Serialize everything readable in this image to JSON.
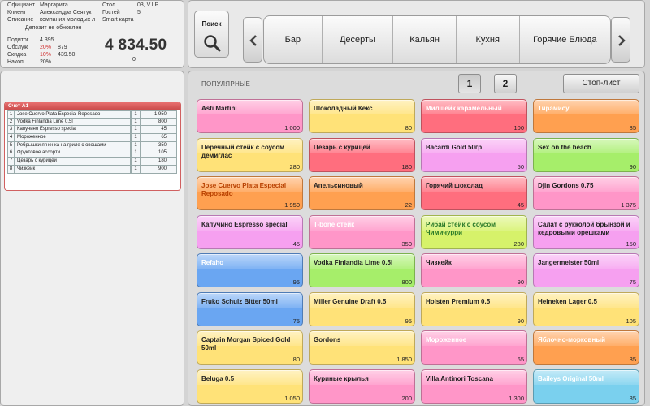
{
  "order_info": {
    "waiter_label": "Официант",
    "waiter_value": "Маргарита",
    "client_label": "Клиент",
    "client_value": "Александра Сеятук",
    "description_label": "Описание",
    "description_value": "компания молодых л",
    "table_label": "Стол",
    "table_value": "03, V.I.P",
    "guests_label": "Гостей",
    "guests_value": "5",
    "card_value": "Smart карта",
    "deposit_status": "Депозит не обновлен",
    "subtotal_label": "Подитог",
    "subtotal_value": "4 395",
    "service_label": "Обслуж",
    "service_percent": "20%",
    "service_value": "879",
    "discount_label": "Скидка",
    "discount_percent": "10%",
    "discount_value": "439.50",
    "accum_label": "Накоп.",
    "accum_percent": "20%",
    "total": "4 834.50",
    "paid": "0"
  },
  "search": {
    "label": "Поиск"
  },
  "categories": [
    "Бар",
    "Десерты",
    "Кальян",
    "Кухня",
    "Горячие Блюда"
  ],
  "bill": {
    "title": "Счет А1",
    "rows": [
      {
        "num": "1",
        "name": "Jose Cuervo Plata Especial Reposado",
        "qty": "1",
        "price": "1 950"
      },
      {
        "num": "2",
        "name": "Vodka Finlandia Lime   0.5l",
        "qty": "1",
        "price": "800"
      },
      {
        "num": "3",
        "name": "Капучино Espresso special",
        "qty": "1",
        "price": "45"
      },
      {
        "num": "4",
        "name": "Мороженное",
        "qty": "1",
        "price": "65"
      },
      {
        "num": "5",
        "name": "Ребрышки ягненка на гриле с овощами",
        "qty": "1",
        "price": "350"
      },
      {
        "num": "6",
        "name": "Фруктовое ассорти",
        "qty": "1",
        "price": "105"
      },
      {
        "num": "7",
        "name": "Цезарь с курицей",
        "qty": "1",
        "price": "180"
      },
      {
        "num": "8",
        "name": "Чизкейк",
        "qty": "1",
        "price": "900"
      }
    ]
  },
  "menu": {
    "section_title": "ПОПУЛЯРНЫЕ",
    "pages": [
      "1",
      "2"
    ],
    "stoplist_label": "Стоп-лист",
    "items": [
      {
        "name": "Asti Martini",
        "price": "1 000",
        "color": "#ff96c8",
        "text_color": "#222222"
      },
      {
        "name": "Шоколадный Кекс",
        "price": "80",
        "color": "#ffe278",
        "text_color": "#222222"
      },
      {
        "name": "Милшейк карамельный",
        "price": "100",
        "color": "#ff6e7e",
        "text_color": "#ffffff"
      },
      {
        "name": "Тирамису",
        "price": "85",
        "color": "#ffa050",
        "text_color": "#ffffff"
      },
      {
        "name": "Перечный стейк с соусом демиглас",
        "price": "280",
        "color": "#ffe278",
        "text_color": "#222222"
      },
      {
        "name": "Цезарь с курицей",
        "price": "180",
        "color": "#ff6e7e",
        "text_color": "#222222"
      },
      {
        "name": "Bacardi Gold 50гр",
        "price": "50",
        "color": "#f6a0f0",
        "text_color": "#222222"
      },
      {
        "name": "Sex on the beach",
        "price": "90",
        "color": "#a6ee6a",
        "text_color": "#222222"
      },
      {
        "name": "Jose Cuervo Plata Especial Reposado",
        "price": "1 950",
        "color": "#ffa050",
        "text_color": "#b84000"
      },
      {
        "name": "Апельсиновый",
        "price": "22",
        "color": "#ffa050",
        "text_color": "#222222"
      },
      {
        "name": "Горячий шоколад",
        "price": "45",
        "color": "#ff6e7e",
        "text_color": "#222222"
      },
      {
        "name": "Djin Gordons 0.75",
        "price": "1 375",
        "color": "#ff96c8",
        "text_color": "#222222"
      },
      {
        "name": "Капучино Espresso special",
        "price": "45",
        "color": "#f6a0f0",
        "text_color": "#222222"
      },
      {
        "name": "T-bone стейк",
        "price": "350",
        "color": "#ff96c8",
        "text_color": "#ffffff"
      },
      {
        "name": "Рибай стейк с соусом Чимичурри",
        "price": "280",
        "color": "#d6f26a",
        "text_color": "#2a7a2a"
      },
      {
        "name": "Салат с рукколой брынзой и кедровыми орешками",
        "price": "150",
        "color": "#f6a0f0",
        "text_color": "#222222"
      },
      {
        "name": "Refaho",
        "price": "95",
        "color": "#6aa6f2",
        "text_color": "#ffffff"
      },
      {
        "name": "Vodka Finlandia Lime   0.5l",
        "price": "800",
        "color": "#a6ee6a",
        "text_color": "#222222"
      },
      {
        "name": "Чизкейк",
        "price": "90",
        "color": "#ff96c8",
        "text_color": "#222222"
      },
      {
        "name": "Jangermeister   50ml",
        "price": "75",
        "color": "#f6a0f0",
        "text_color": "#222222"
      },
      {
        "name": "Fruko Schulz Bitter   50ml",
        "price": "75",
        "color": "#6aa6f2",
        "text_color": "#222222"
      },
      {
        "name": "Miller Genuine Draft   0.5",
        "price": "95",
        "color": "#ffe278",
        "text_color": "#222222"
      },
      {
        "name": "Holsten Premium   0.5",
        "price": "90",
        "color": "#ffe278",
        "text_color": "#222222"
      },
      {
        "name": "Heineken Lager   0.5",
        "price": "105",
        "color": "#ffe278",
        "text_color": "#222222"
      },
      {
        "name": "Captain Morgan Spiced Gold 50ml",
        "price": "80",
        "color": "#ffe278",
        "text_color": "#222222"
      },
      {
        "name": "Gordons",
        "price": "1 850",
        "color": "#ffe278",
        "text_color": "#222222"
      },
      {
        "name": "Мороженное",
        "price": "65",
        "color": "#ff96c8",
        "text_color": "#ffffff"
      },
      {
        "name": "Яблочно-морковный",
        "price": "85",
        "color": "#ffa050",
        "text_color": "#ffffff"
      },
      {
        "name": "Beluga   0.5",
        "price": "1 050",
        "color": "#ffe278",
        "text_color": "#222222"
      },
      {
        "name": "Куриные крылья",
        "price": "200",
        "color": "#ff96c8",
        "text_color": "#222222"
      },
      {
        "name": "Villa Antinori Toscana",
        "price": "1 300",
        "color": "#ff96c8",
        "text_color": "#222222"
      },
      {
        "name": "Baileys Original   50ml",
        "price": "85",
        "color": "#7ad0ee",
        "text_color": "#ffffff"
      }
    ]
  }
}
